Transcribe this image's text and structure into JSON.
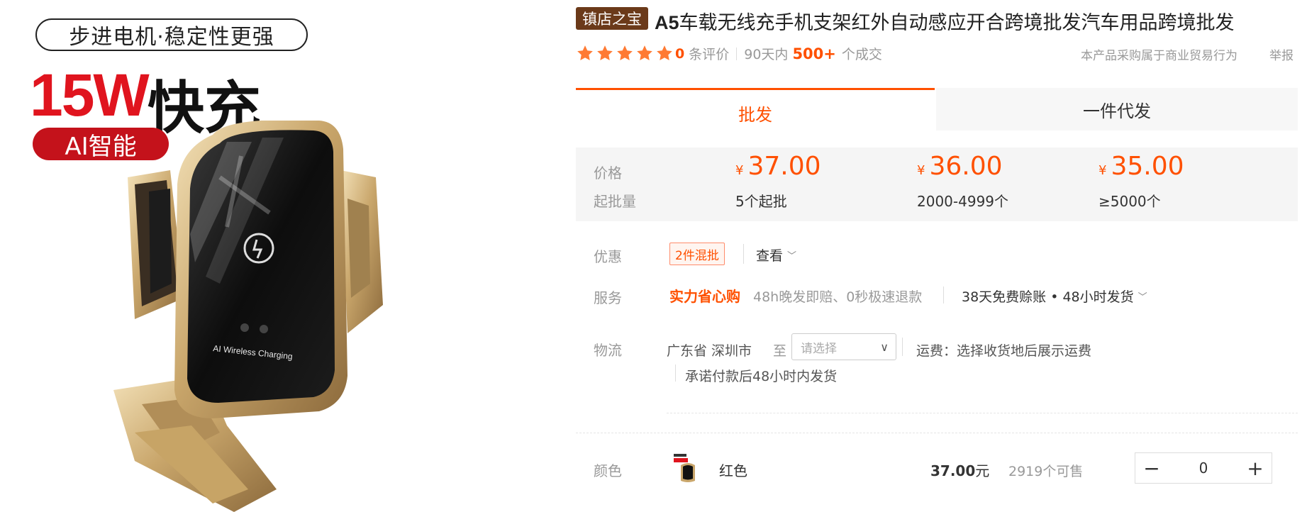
{
  "image": {
    "headline_pill": "步进电机·稳定性更强",
    "headline_power": "15W",
    "headline_fast": "快充",
    "ai_pill": "AI智能",
    "charger_text": "AI Wireless Charging"
  },
  "product": {
    "badge": "镇店之宝",
    "title_model": "A5",
    "title_rest": "车载无线充手机支架红外自动感应开合跨境批发汽车用品跨境批发"
  },
  "rating": {
    "stars": 5,
    "review_count": "0",
    "review_label": "条评价",
    "days_label": "90天内",
    "sold_count": "500+",
    "sold_label": "个成交",
    "biz_note": "本产品采购属于商业贸易行为",
    "report": "举报"
  },
  "tabs": [
    {
      "label": "批发",
      "active": true
    },
    {
      "label": "一件代发",
      "active": false
    }
  ],
  "pricing": {
    "price_label": "价格",
    "moq_label": "起批量",
    "currency": "¥",
    "tiers": [
      {
        "price": "37.00",
        "qty": "5个起批"
      },
      {
        "price": "36.00",
        "qty": "2000-4999个"
      },
      {
        "price": "35.00",
        "qty": "≥5000个"
      }
    ]
  },
  "promo": {
    "label": "优惠",
    "coupon": "2件混批",
    "view": "查看"
  },
  "service": {
    "label": "服务",
    "strong": "实力省心购",
    "items": "48h晚发即赔、0秒极速退款",
    "extra": "38天免费赊账 • 48小时发货"
  },
  "logistics": {
    "label": "物流",
    "from": "广东省  深圳市",
    "to": "至",
    "placeholder": "请选择",
    "freight": "运费：选择收货地后展示运费",
    "promise": "承诺付款后48小时内发货"
  },
  "sku": {
    "label": "颜色",
    "name": "红色",
    "price": "37.00",
    "unit": "元",
    "stock": "2919个可售",
    "qty": "0",
    "minus": "−",
    "plus": "+"
  },
  "colors": {
    "accent": "#ff5000",
    "badge_bg": "#6b3a1a",
    "price_bg": "#f5f5f5",
    "red_text": "#e0141e"
  }
}
